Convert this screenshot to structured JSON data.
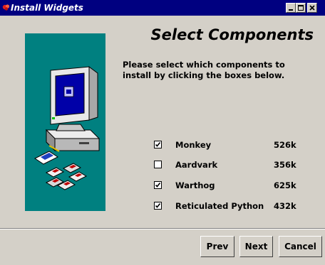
{
  "window": {
    "title": "Install Widgets",
    "title_bar_color": "#000080",
    "icons": [
      "app-icon",
      "minimize-icon",
      "maximize-icon",
      "close-icon"
    ]
  },
  "page": {
    "heading": "Select Components",
    "instructions": "Please select which components to install by clicking the boxes below.",
    "side_panel_color": "#008080",
    "side_panel_illustration": "computer-with-floppy-disks"
  },
  "components": [
    {
      "name": "Monkey",
      "size": "526k",
      "checked": true
    },
    {
      "name": "Aardvark",
      "size": "356k",
      "checked": false
    },
    {
      "name": "Warthog",
      "size": "625k",
      "checked": true
    },
    {
      "name": "Reticulated Python",
      "size": "432k",
      "checked": true
    }
  ],
  "buttons": {
    "prev": "Prev",
    "next": "Next",
    "cancel": "Cancel"
  }
}
